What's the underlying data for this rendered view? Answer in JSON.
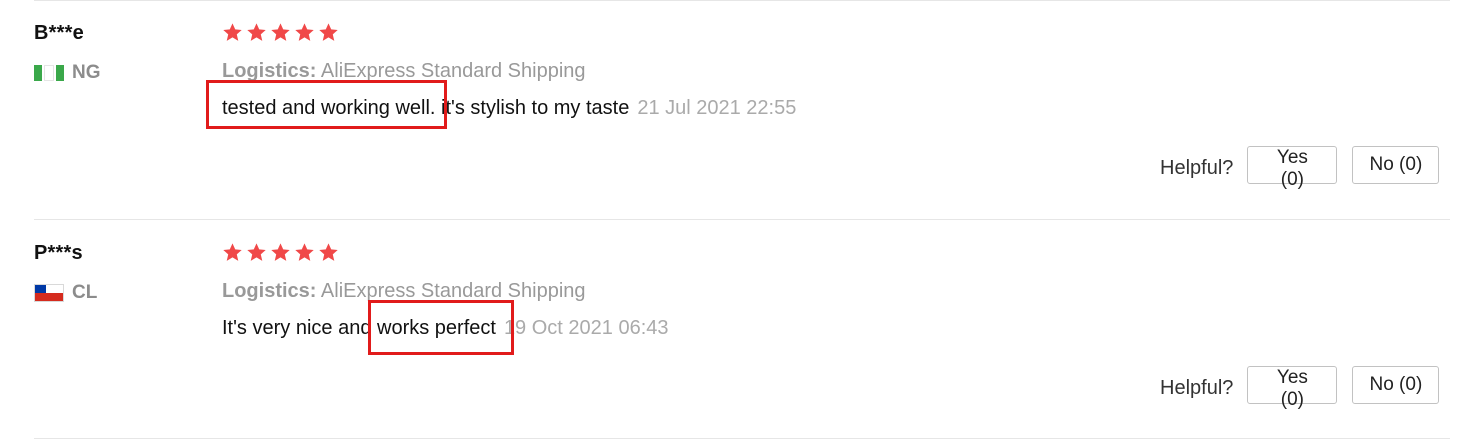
{
  "helpful_label": "Helpful?",
  "logistics_label": "Logistics:",
  "star_color": "#f04848",
  "highlight_color": "#e11b1b",
  "reviews": [
    {
      "user": "B***e",
      "country_code": "NG",
      "flag": "nigeria-flag",
      "rating": 5,
      "logistics": "AliExpress Standard Shipping",
      "comment_highlight": "tested and working well.",
      "comment_rest": " it's stylish to my taste",
      "date": "21 Jul 2021 22:55",
      "yes_label": "Yes (0)",
      "no_label": "No (0)"
    },
    {
      "user": "P***s",
      "country_code": "CL",
      "flag": "chile-flag",
      "rating": 5,
      "logistics": "AliExpress Standard Shipping",
      "comment_prefix": "It's very nice and ",
      "comment_highlight": "works perfect",
      "date": "19 Oct 2021 06:43",
      "yes_label": "Yes (0)",
      "no_label": "No (0)"
    }
  ]
}
